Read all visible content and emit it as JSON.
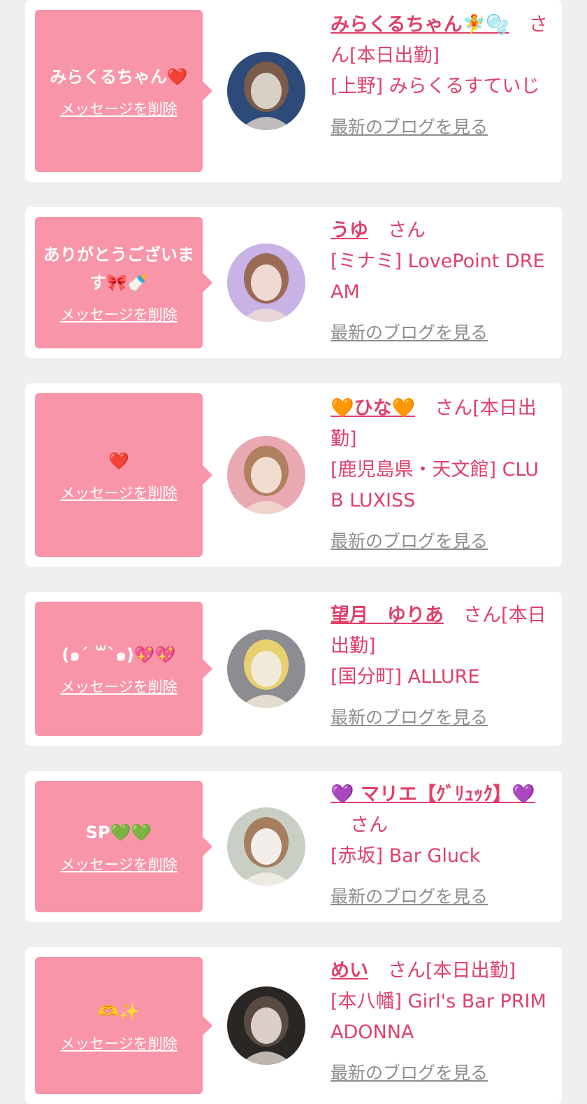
{
  "cards": [
    {
      "message": "みらくるちゃん❤️",
      "delete_label": "メッセージを削除",
      "name": "みらくるちゃん🧚🫧",
      "suffix": "さん[本日出勤]",
      "store": "[上野] みらくるすていじ",
      "blog_label": "最新のブログを見る",
      "avatar_colors": [
        "#2d4a78",
        "#d8cfc6",
        "#7a5a48"
      ]
    },
    {
      "message": "ありがとうございます🎀🍼",
      "delete_label": "メッセージを削除",
      "name": "うゆ",
      "suffix": "さん",
      "store": "[ミナミ] LovePoint DREAM",
      "blog_label": "最新のブログを見る",
      "avatar_colors": [
        "#c9b2e6",
        "#efd9d4",
        "#9a6a55"
      ]
    },
    {
      "message": "❤️",
      "delete_label": "メッセージを削除",
      "name": "🧡ひな🧡",
      "suffix": "さん[本日出勤]",
      "store": "[鹿児島県・天文館] CLUB LUXISS",
      "blog_label": "最新のブログを見る",
      "avatar_colors": [
        "#e9a9b3",
        "#f1dcd0",
        "#b08060"
      ]
    },
    {
      "message": "(๑´ ꒳`๑)💖💖",
      "delete_label": "メッセージを削除",
      "name": "望月　ゆりあ",
      "suffix": "さん[本日出勤]",
      "store": "[国分町] ALLURE",
      "blog_label": "最新のブログを見る",
      "avatar_colors": [
        "#8c8c92",
        "#f2ead8",
        "#e8d070"
      ]
    },
    {
      "message": "SP💚💚",
      "delete_label": "メッセージを削除",
      "name": "💜 マリエ【ｸﾞﾘｭｯｸ】💜",
      "suffix": "さん",
      "store": "[赤坂] Bar Gluck",
      "blog_label": "最新のブログを見る",
      "avatar_colors": [
        "#c9cfc4",
        "#f3eeea",
        "#a57e60"
      ]
    },
    {
      "message": "🫶✨",
      "delete_label": "メッセージを削除",
      "name": "めい",
      "suffix": "さん[本日出勤]",
      "store": "[本八幡] Girl's Bar PRIMADONNA",
      "blog_label": "最新のブログを見る",
      "avatar_colors": [
        "#2a2624",
        "#d9cfc8",
        "#5a4a44"
      ]
    }
  ]
}
